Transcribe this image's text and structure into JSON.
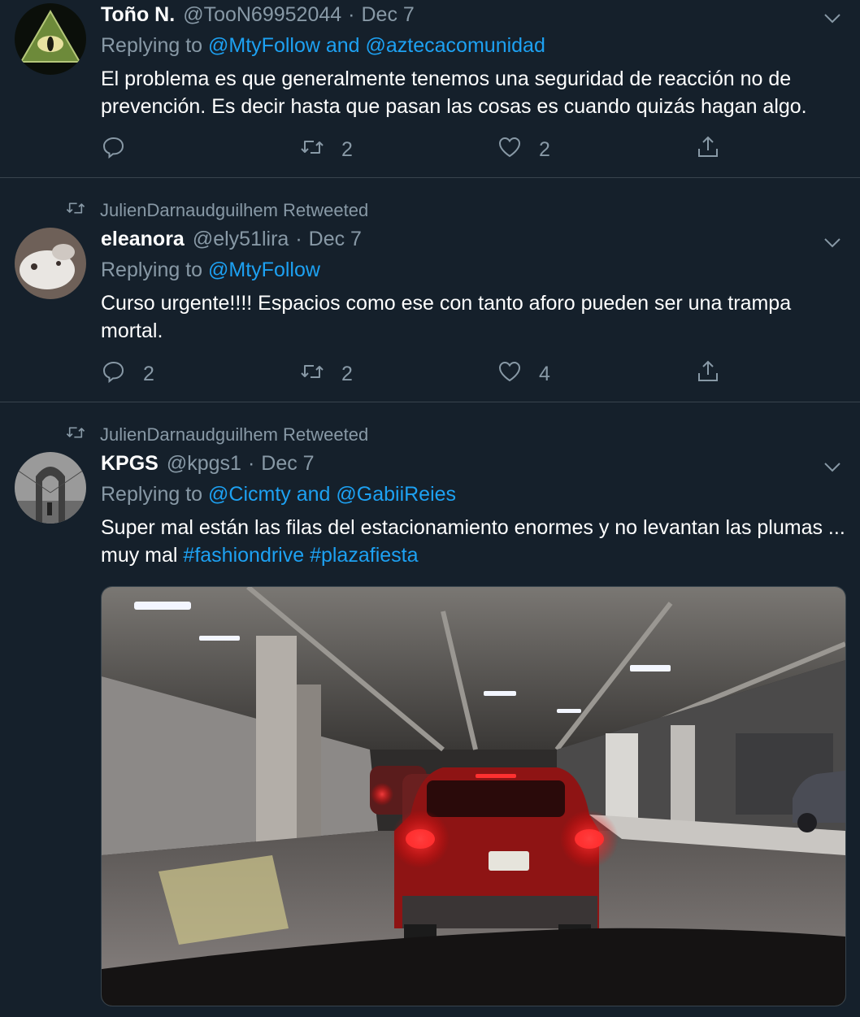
{
  "tweets": [
    {
      "name": "Toño N.",
      "handle": "@TooN69952044",
      "sep": "·",
      "date": "Dec 7",
      "replying_prefix": "Replying to",
      "replying_to": "@MtyFollow and @aztecacomunidad",
      "text": "El problema es que generalmente tenemos una seguridad de reacción no de prevención. Es decir hasta que pasan las cosas es cuando quizás hagan algo.",
      "reply_count": "",
      "retweet_count": "2",
      "like_count": "2"
    },
    {
      "retweeted_by": "JulienDarnaudguilhem Retweeted",
      "name": "eleanora",
      "handle": "@ely51lira",
      "sep": "·",
      "date": "Dec 7",
      "replying_prefix": "Replying to",
      "replying_to": "@MtyFollow",
      "text": "Curso urgente!!!! Espacios como ese con tanto aforo pueden ser una trampa mortal.",
      "reply_count": "2",
      "retweet_count": "2",
      "like_count": "4"
    },
    {
      "retweeted_by": "JulienDarnaudguilhem Retweeted",
      "name": "KPGS",
      "handle": "@kpgs1",
      "sep": "·",
      "date": "Dec 7",
      "replying_prefix": "Replying to",
      "replying_to": "@Cicmty and @GabiiReies",
      "text": "Super mal están las filas del estacionamiento enormes y no levantan las plumas ... muy mal",
      "hashtags": "#fashiondrive #plazafiesta"
    }
  ],
  "icons": {
    "retweet_context": "retweet-icon",
    "menu": "chevron-down-icon",
    "reply": "reply-icon",
    "retweet": "retweet-icon",
    "like": "heart-icon",
    "share": "share-icon"
  },
  "colors": {
    "background": "#15202b",
    "secondary_text": "#8899a6",
    "link": "#1da1f2",
    "divider": "#38444d"
  }
}
